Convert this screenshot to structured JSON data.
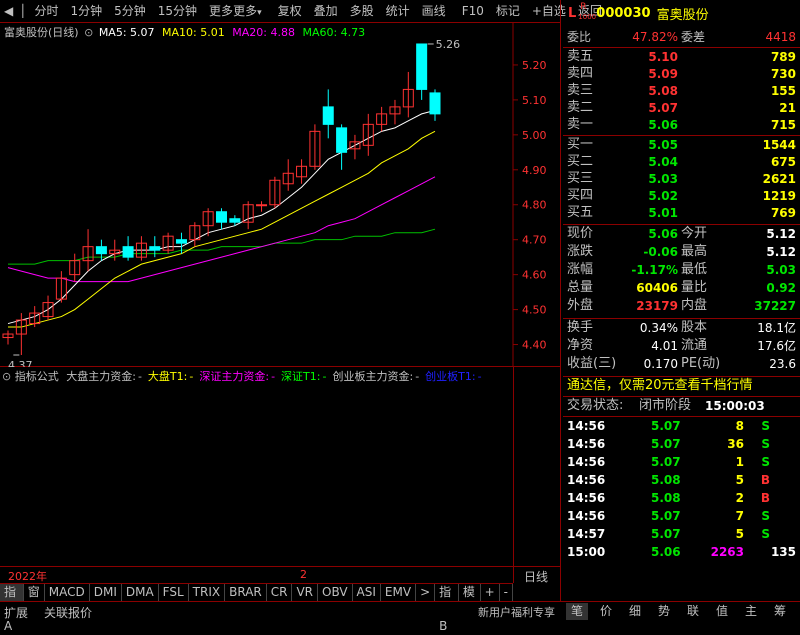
{
  "toolbar": {
    "items": [
      "分时",
      "1分钟",
      "5分钟",
      "15分钟",
      "更多",
      "复权",
      "叠加",
      "多股",
      "统计",
      "画线",
      "F10",
      "标记",
      "+自选",
      "返回"
    ]
  },
  "stock": {
    "code": "000030",
    "name": "富奥股份",
    "badge_l": "L",
    "badge_r": "R",
    "badge_num": "1000"
  },
  "chart": {
    "title": "富奥股份(日线)",
    "ma5_label": "MA5: 5.07",
    "ma10_label": "MA10: 5.01",
    "ma20_label": "MA20: 4.88",
    "ma60_label": "MA60: 4.73",
    "high_label": "5.26",
    "low_label": "4.37",
    "x_label_year": "2022年",
    "x_label_2": "2",
    "period_label": "日线",
    "y_ticks": [
      "5.20",
      "5.10",
      "5.00",
      "4.90",
      "4.80",
      "4.70",
      "4.60",
      "4.50",
      "4.40"
    ]
  },
  "chart_data": {
    "type": "candlestick",
    "ylim": [
      4.35,
      5.3
    ],
    "candles": [
      [
        4.42,
        4.43,
        4.4,
        4.44
      ],
      [
        4.43,
        4.47,
        4.37,
        4.49
      ],
      [
        4.46,
        4.49,
        4.45,
        4.51
      ],
      [
        4.48,
        4.52,
        4.47,
        4.54
      ],
      [
        4.53,
        4.59,
        4.52,
        4.61
      ],
      [
        4.6,
        4.64,
        4.58,
        4.66
      ],
      [
        4.64,
        4.68,
        4.61,
        4.73
      ],
      [
        4.68,
        4.66,
        4.64,
        4.7
      ],
      [
        4.66,
        4.67,
        4.64,
        4.7
      ],
      [
        4.68,
        4.65,
        4.64,
        4.71
      ],
      [
        4.65,
        4.69,
        4.64,
        4.71
      ],
      [
        4.68,
        4.67,
        4.65,
        4.71
      ],
      [
        4.67,
        4.71,
        4.66,
        4.72
      ],
      [
        4.7,
        4.69,
        4.66,
        4.72
      ],
      [
        4.7,
        4.74,
        4.68,
        4.75
      ],
      [
        4.74,
        4.78,
        4.71,
        4.79
      ],
      [
        4.78,
        4.75,
        4.73,
        4.79
      ],
      [
        4.76,
        4.75,
        4.74,
        4.77
      ],
      [
        4.75,
        4.8,
        4.73,
        4.81
      ],
      [
        4.8,
        4.8,
        4.78,
        4.81
      ],
      [
        4.8,
        4.87,
        4.79,
        4.88
      ],
      [
        4.86,
        4.89,
        4.84,
        4.93
      ],
      [
        4.88,
        4.91,
        4.86,
        4.93
      ],
      [
        4.91,
        5.01,
        4.9,
        5.03
      ],
      [
        5.08,
        5.03,
        4.99,
        5.13
      ],
      [
        5.02,
        4.95,
        4.9,
        5.03
      ],
      [
        4.96,
        4.98,
        4.93,
        5.0
      ],
      [
        4.97,
        5.03,
        4.94,
        5.06
      ],
      [
        5.03,
        5.06,
        5.01,
        5.08
      ],
      [
        5.06,
        5.08,
        5.03,
        5.1
      ],
      [
        5.08,
        5.13,
        5.05,
        5.18
      ],
      [
        5.26,
        5.13,
        5.1,
        5.26
      ],
      [
        5.12,
        5.06,
        5.04,
        5.13
      ]
    ],
    "ma5": [
      4.46,
      4.47,
      4.48,
      4.5,
      4.53,
      4.57,
      4.61,
      4.64,
      4.66,
      4.67,
      4.67,
      4.67,
      4.68,
      4.68,
      4.7,
      4.72,
      4.73,
      4.74,
      4.76,
      4.77,
      4.79,
      4.82,
      4.85,
      4.89,
      4.93,
      4.95,
      4.97,
      4.99,
      5.01,
      5.02,
      5.04,
      5.06,
      5.07
    ],
    "ma10": [
      4.45,
      4.45,
      4.46,
      4.47,
      4.48,
      4.5,
      4.53,
      4.56,
      4.59,
      4.61,
      4.63,
      4.64,
      4.65,
      4.66,
      4.68,
      4.69,
      4.7,
      4.71,
      4.72,
      4.73,
      4.75,
      4.77,
      4.79,
      4.81,
      4.83,
      4.85,
      4.87,
      4.89,
      4.92,
      4.94,
      4.96,
      4.99,
      5.01
    ],
    "ma20": [
      4.62,
      4.61,
      4.6,
      4.59,
      4.59,
      4.58,
      4.58,
      4.58,
      4.58,
      4.58,
      4.59,
      4.6,
      4.61,
      4.62,
      4.63,
      4.64,
      4.65,
      4.66,
      4.67,
      4.68,
      4.69,
      4.7,
      4.71,
      4.72,
      4.74,
      4.75,
      4.76,
      4.78,
      4.8,
      4.82,
      4.84,
      4.86,
      4.88
    ],
    "ma60": [
      4.63,
      4.63,
      4.63,
      4.64,
      4.64,
      4.64,
      4.65,
      4.65,
      4.65,
      4.66,
      4.66,
      4.66,
      4.66,
      4.67,
      4.67,
      4.67,
      4.68,
      4.68,
      4.68,
      4.68,
      4.69,
      4.69,
      4.69,
      4.7,
      4.7,
      4.7,
      4.71,
      4.71,
      4.71,
      4.72,
      4.72,
      4.72,
      4.73
    ]
  },
  "indicator": {
    "name": "指标公式",
    "items": [
      {
        "text": "大盘主力资金:",
        "color": "#c0c0c0"
      },
      {
        "text": "-",
        "color": "#c0c0c0"
      },
      {
        "text": "大盘T1:",
        "color": "#ffff00"
      },
      {
        "text": "-",
        "color": "#ffff00"
      },
      {
        "text": "深证主力资金:",
        "color": "#ff00ff"
      },
      {
        "text": "-",
        "color": "#ff00ff"
      },
      {
        "text": "深证T1:",
        "color": "#00ff00"
      },
      {
        "text": "-",
        "color": "#00ff00"
      },
      {
        "text": "创业板主力资金:",
        "color": "#c0c0c0"
      },
      {
        "text": "-",
        "color": "#c0c0c0"
      },
      {
        "text": "创业板T1:",
        "color": "#2020ff"
      },
      {
        "text": "-",
        "color": "#2020ff"
      }
    ]
  },
  "bottom_tabs": [
    "指标A",
    "窗口",
    "MACD",
    "DMI",
    "DMA",
    "FSL",
    "TRIX",
    "BRAR",
    "CR",
    "VR",
    "OBV",
    "ASI",
    "EMV",
    ">",
    "指标B",
    "模 板",
    "+",
    "-"
  ],
  "status_bar": {
    "left1": "扩展",
    "left2": "关联报价",
    "promo": "新用户福利专享",
    "nav": [
      "笔",
      "价",
      "细",
      "势",
      "联",
      "值",
      "主",
      "筹"
    ]
  },
  "quote": {
    "weibi_label": "委比",
    "weibi_value": "47.82%",
    "weicha_label": "委差",
    "weicha_value": "4418",
    "asks": [
      {
        "label": "卖五",
        "price": "5.10",
        "vol": "789"
      },
      {
        "label": "卖四",
        "price": "5.09",
        "vol": "730"
      },
      {
        "label": "卖三",
        "price": "5.08",
        "vol": "155"
      },
      {
        "label": "卖二",
        "price": "5.07",
        "vol": "21"
      },
      {
        "label": "卖一",
        "price": "5.06",
        "vol": "715"
      }
    ],
    "bids": [
      {
        "label": "买一",
        "price": "5.05",
        "vol": "1544"
      },
      {
        "label": "买二",
        "price": "5.04",
        "vol": "675"
      },
      {
        "label": "买三",
        "price": "5.03",
        "vol": "2621"
      },
      {
        "label": "买四",
        "price": "5.02",
        "vol": "1219"
      },
      {
        "label": "买五",
        "price": "5.01",
        "vol": "769"
      }
    ],
    "stats": [
      {
        "l1": "现价",
        "v1": "5.06",
        "c1": "green",
        "l2": "今开",
        "v2": "5.12",
        "c2": "white"
      },
      {
        "l1": "涨跌",
        "v1": "-0.06",
        "c1": "green",
        "l2": "最高",
        "v2": "5.12",
        "c2": "white"
      },
      {
        "l1": "涨幅",
        "v1": "-1.17%",
        "c1": "green",
        "l2": "最低",
        "v2": "5.03",
        "c2": "green"
      },
      {
        "l1": "总量",
        "v1": "60406",
        "c1": "yellow",
        "l2": "量比",
        "v2": "0.92",
        "c2": "green"
      },
      {
        "l1": "外盘",
        "v1": "23179",
        "c1": "red",
        "l2": "内盘",
        "v2": "37227",
        "c2": "green"
      }
    ],
    "stats2": [
      {
        "l1": "换手",
        "v1": "0.34%",
        "l2": "股本",
        "v2": "18.1亿"
      },
      {
        "l1": "净资",
        "v1": "4.01",
        "l2": "流通",
        "v2": "17.6亿"
      },
      {
        "l1": "收益(三)",
        "v1": "0.170",
        "l2": "PE(动)",
        "v2": "23.6"
      }
    ],
    "promo": "通达信，仅需20元查看千档行情",
    "trade_state_label": "交易状态:",
    "trade_state_value": "闭市阶段",
    "trade_time": "15:00:03",
    "ticks": [
      {
        "time": "14:56",
        "price": "5.07",
        "vol": "8",
        "bs": "S",
        "vc": "yellow",
        "bc": "green"
      },
      {
        "time": "14:56",
        "price": "5.07",
        "vol": "36",
        "bs": "S",
        "vc": "yellow",
        "bc": "green"
      },
      {
        "time": "14:56",
        "price": "5.07",
        "vol": "1",
        "bs": "S",
        "vc": "yellow",
        "bc": "green"
      },
      {
        "time": "14:56",
        "price": "5.08",
        "vol": "5",
        "bs": "B",
        "vc": "yellow",
        "bc": "red"
      },
      {
        "time": "14:56",
        "price": "5.08",
        "vol": "2",
        "bs": "B",
        "vc": "yellow",
        "bc": "red"
      },
      {
        "time": "14:56",
        "price": "5.07",
        "vol": "7",
        "bs": "S",
        "vc": "yellow",
        "bc": "green"
      },
      {
        "time": "14:57",
        "price": "5.07",
        "vol": "5",
        "bs": "S",
        "vc": "yellow",
        "bc": "green"
      },
      {
        "time": "15:00",
        "price": "5.06",
        "vol": "2263",
        "bs": "135",
        "vc": "magenta",
        "bc": "white"
      }
    ]
  }
}
